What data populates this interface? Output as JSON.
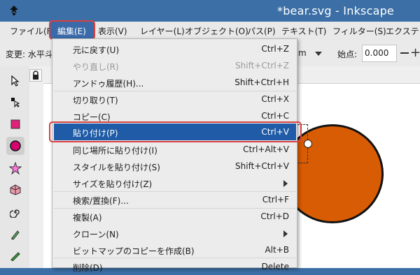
{
  "window": {
    "title": "*bear.svg - Inkscape"
  },
  "menubar": {
    "file": "ファイル(F)",
    "edit": "編集(E)",
    "view": "表示(V)",
    "layer": "レイヤー(L)",
    "object": "オブジェクト(O)",
    "path": "パス(P)",
    "text": "テキスト(T)",
    "filter": "フィルター(S)",
    "extensions": "エクステンシ"
  },
  "toolbar": {
    "transform_label": "変更: 水平斗",
    "unit": "m",
    "start_label": "始点:",
    "start_value": "0.000"
  },
  "tools": [
    "selector-icon",
    "node-icon",
    "rect-icon",
    "ellipse-icon",
    "star-icon",
    "box3d-icon",
    "spiral-icon",
    "pencil-icon",
    "pen-icon"
  ],
  "edit_menu": {
    "items": [
      {
        "label": "元に戻す(U)",
        "shortcut": "Ctrl+Z",
        "disabled": false
      },
      {
        "label": "やり直し(R)",
        "shortcut": "Shift+Ctrl+Z",
        "disabled": true
      },
      {
        "label": "アンドゥ履歴(H)...",
        "shortcut": "Shift+Ctrl+H",
        "disabled": false
      },
      {
        "label": "切り取り(T)",
        "shortcut": "Ctrl+X",
        "disabled": false
      },
      {
        "label": "コピー(C)",
        "shortcut": "Ctrl+C",
        "disabled": false
      },
      {
        "label": "貼り付け(P)",
        "shortcut": "Ctrl+V",
        "highlighted": true
      },
      {
        "label": "同じ場所に貼り付け(I)",
        "shortcut": "Ctrl+Alt+V",
        "disabled": false
      },
      {
        "label": "スタイルを貼り付け(S)",
        "shortcut": "Shift+Ctrl+V",
        "disabled": false
      },
      {
        "label": "サイズを貼り付け(Z)",
        "submenu": true
      },
      {
        "label": "検索/置換(F)...",
        "shortcut": "Ctrl+F",
        "disabled": false
      },
      {
        "label": "複製(A)",
        "shortcut": "Ctrl+D",
        "disabled": false
      },
      {
        "label": "クローン(N)",
        "submenu": true
      },
      {
        "label": "ビットマップのコピーを作成(B)",
        "shortcut": "Alt+B",
        "disabled": false
      },
      {
        "label": "削除(D)",
        "shortcut": "Delete",
        "disabled": false
      }
    ]
  },
  "colors": {
    "titlebar": "#3b6fa6",
    "highlight": "#1f5ba6",
    "callout": "#d94040",
    "ellipse_fill": "#d85c04"
  }
}
